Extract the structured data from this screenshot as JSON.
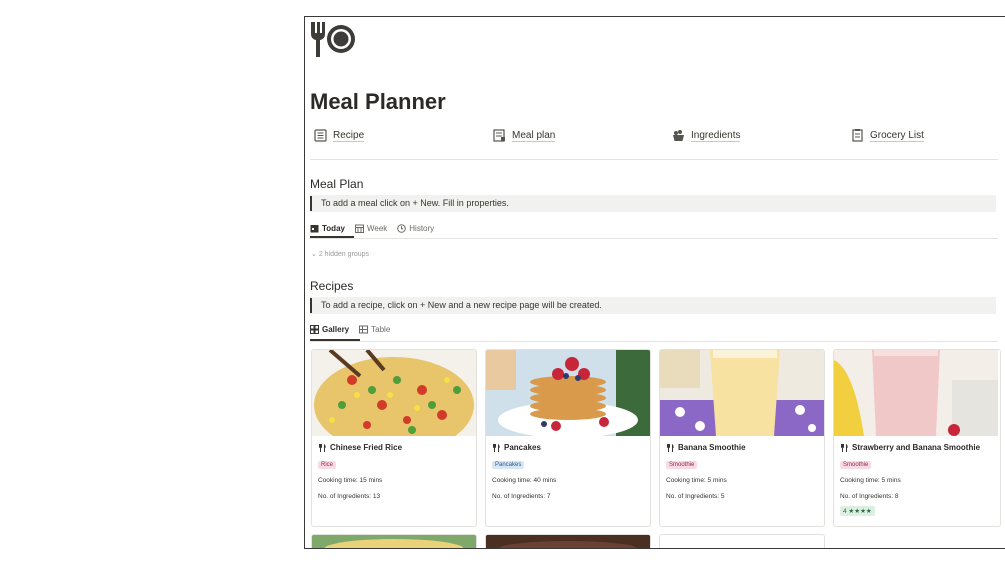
{
  "page": {
    "title": "Meal Planner",
    "icon": "fork-plate-icon"
  },
  "links": [
    {
      "label": "Recipe",
      "icon": "recipe-book-icon"
    },
    {
      "label": "Meal plan",
      "icon": "meal-plan-icon"
    },
    {
      "label": "Ingredients",
      "icon": "ingredients-basket-icon"
    },
    {
      "label": "Grocery List",
      "icon": "grocery-list-icon"
    }
  ],
  "meal_plan": {
    "heading": "Meal Plan",
    "callout": "To add a meal click on + New. Fill in properties.",
    "tabs": [
      {
        "label": "Today",
        "icon": "calendar-today-icon"
      },
      {
        "label": "Week",
        "icon": "calendar-week-icon"
      },
      {
        "label": "History",
        "icon": "clock-icon"
      }
    ],
    "hidden_groups": "2 hidden groups"
  },
  "recipes": {
    "heading": "Recipes",
    "callout": "To add a recipe, click on + New and a new recipe page will be created.",
    "tabs": [
      {
        "label": "Gallery",
        "icon": "gallery-icon"
      },
      {
        "label": "Table",
        "icon": "table-icon"
      }
    ],
    "cards": [
      {
        "name": "Chinese Fried Rice",
        "tag": "Rice",
        "cooking": "Cooking time: 15 mins",
        "ingredients": "No. of Ingredients: 13"
      },
      {
        "name": "Pancakes",
        "tag": "Pancakes",
        "cooking": "Cooking time: 40 mins",
        "ingredients": "No. of Ingredients: 7"
      },
      {
        "name": "Banana Smoothie",
        "tag": "Smoothie",
        "cooking": "Cooking time: 5 mins",
        "ingredients": "No. of Ingredients: 5"
      },
      {
        "name": "Strawberry and Banana Smoothie",
        "tag": "Smoothie",
        "cooking": "Cooking time: 5 mins",
        "ingredients": "No. of Ingredients: 8",
        "rating": "4 ★★★★"
      }
    ]
  }
}
